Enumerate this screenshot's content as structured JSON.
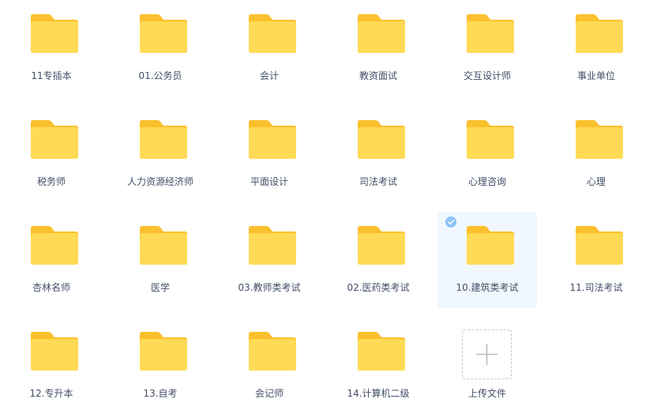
{
  "colors": {
    "folder_back": "#FBC02D",
    "folder_front": "#FFDA55",
    "label": "#424e67",
    "selected_bg": "#f1f7fe",
    "check": "#8cc2fa"
  },
  "icons": {
    "folder": "folder-icon",
    "check": "check-circle-icon",
    "plus": "plus-icon"
  },
  "folders": [
    {
      "name": "11专插本"
    },
    {
      "name": "01.公务员"
    },
    {
      "name": "会计"
    },
    {
      "name": "教资面试"
    },
    {
      "name": "交互设计师"
    },
    {
      "name": "事业单位"
    },
    {
      "name": "税务师"
    },
    {
      "name": "人力资源经济师"
    },
    {
      "name": "平面设计"
    },
    {
      "name": "司法考试"
    },
    {
      "name": "心理咨询"
    },
    {
      "name": "心理"
    },
    {
      "name": "杏林名师"
    },
    {
      "name": "医学"
    },
    {
      "name": "03.教师类考试"
    },
    {
      "name": "02.医药类考试"
    },
    {
      "name": "10.建筑类考试",
      "selected": true
    },
    {
      "name": "11.司法考试"
    },
    {
      "name": "12.专升本"
    },
    {
      "name": "13.自考"
    },
    {
      "name": "会记师"
    },
    {
      "name": "14.计算机二级"
    }
  ],
  "upload": {
    "label": "上传文件"
  }
}
